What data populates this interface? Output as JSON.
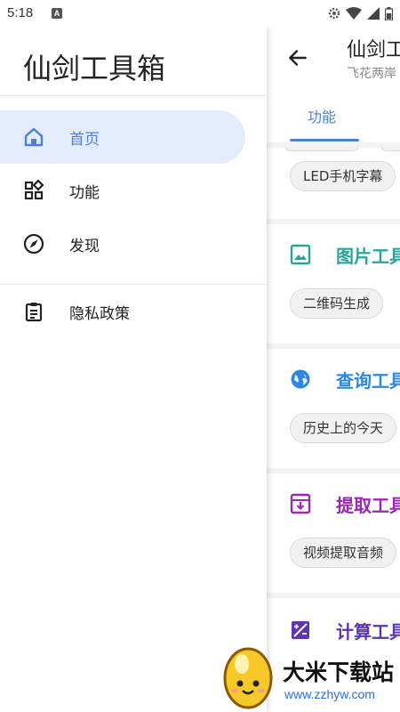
{
  "status_bar": {
    "time": "5:18",
    "notification_letter": "A",
    "icons": [
      "gear-icon",
      "wifi-icon",
      "signal-icon",
      "battery-icon"
    ]
  },
  "drawer": {
    "title": "仙剑工具箱",
    "items": [
      {
        "label": "首页",
        "icon": "home-icon",
        "active": true
      },
      {
        "label": "功能",
        "icon": "grid-icon",
        "active": false
      },
      {
        "label": "发现",
        "icon": "compass-icon",
        "active": false
      },
      {
        "label": "隐私政策",
        "icon": "clipboard-icon",
        "active": false
      }
    ]
  },
  "app": {
    "title": "仙剑工",
    "subtitle": "飞花两岸",
    "tab_label": "功能",
    "top_chip": "LED手机字幕",
    "sections": [
      {
        "title": "图片工具",
        "color": "#26a69a",
        "icon": "image-icon",
        "chip": "二维码生成"
      },
      {
        "title": "查询工具",
        "color": "#2e86de",
        "icon": "globe-icon",
        "chip": "历史上的今天"
      },
      {
        "title": "提取工具",
        "color": "#9c27b0",
        "icon": "archive-icon",
        "chip": "视频提取音频"
      },
      {
        "title": "计算工具",
        "color": "#5e35b1",
        "icon": "calculator-icon"
      }
    ]
  },
  "watermark": {
    "text": "大米下载站",
    "url": "www.zzhyw.com"
  },
  "colors": {
    "accent": "#4e7fd6",
    "active_bg": "#e3ecfb"
  }
}
